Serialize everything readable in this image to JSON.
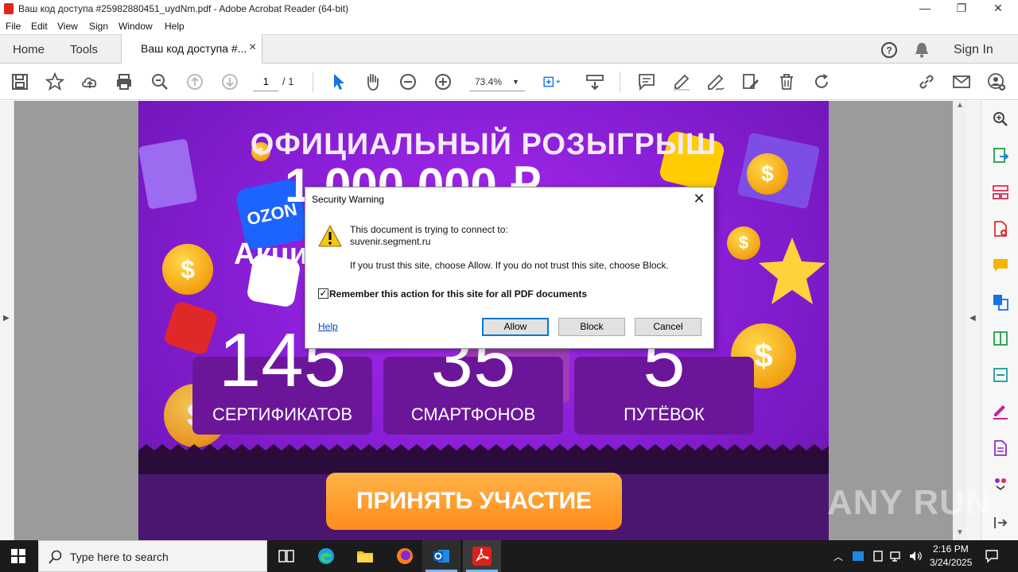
{
  "window": {
    "title": "Ваш код доступа #25982880451_uydNm.pdf - Adobe Acrobat Reader (64-bit)",
    "minimize": "—",
    "maximize": "❐",
    "close": "✕"
  },
  "menu": [
    "File",
    "Edit",
    "View",
    "Sign",
    "Window",
    "Help"
  ],
  "tabs": {
    "home": "Home",
    "tools": "Tools",
    "doc": "Ваш код доступа #...",
    "doc_close": "×",
    "signin": "Sign In"
  },
  "toolbar": {
    "page_current": "1",
    "page_total": "/ 1",
    "zoom": "73.4%"
  },
  "pdf": {
    "headline": "ОФИЦИАЛЬНЫЙ РОЗЫГРЫШ",
    "amount": "1 000 000 ₽",
    "promo_word": "Акци",
    "ozon": "OZON",
    "stats": [
      {
        "num": "145",
        "label": "СЕРТИФИКАТОВ"
      },
      {
        "num": "35",
        "label": "СМАРТФОНОВ"
      },
      {
        "num": "5",
        "label": "ПУТЁВОК"
      }
    ],
    "cta": "ПРИНЯТЬ УЧАСТИЕ"
  },
  "dialog": {
    "title": "Security Warning",
    "close": "✕",
    "line1": "This document is trying to connect to:",
    "host": "suvenir.segment.ru",
    "advice": "If you trust this site, choose Allow. If you do not trust this site, choose Block.",
    "remember_label": "Remember this action for this site for all PDF documents",
    "remember_checked": true,
    "help": "Help",
    "allow": "Allow",
    "block": "Block",
    "cancel": "Cancel"
  },
  "taskbar": {
    "search_placeholder": "Type here to search",
    "time": "2:16 PM",
    "date": "3/24/2025"
  },
  "watermark": "ANY RUN"
}
